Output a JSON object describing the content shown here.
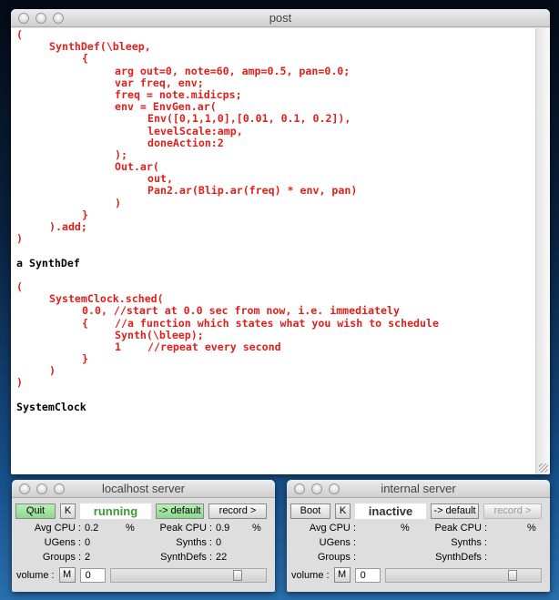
{
  "post": {
    "title": "post",
    "lines": [
      {
        "t": "(",
        "c": "code"
      },
      {
        "t": "\tSynthDef(\\bleep,",
        "c": "code"
      },
      {
        "t": "\t\t{",
        "c": "code"
      },
      {
        "t": "\t\t\targ out=0, note=60, amp=0.5, pan=0.0;",
        "c": "code"
      },
      {
        "t": "\t\t\tvar freq, env;",
        "c": "code"
      },
      {
        "t": "\t\t\tfreq = note.midicps;",
        "c": "code"
      },
      {
        "t": "\t\t\tenv = EnvGen.ar(",
        "c": "code"
      },
      {
        "t": "\t\t\t\tEnv([0,1,1,0],[0.01, 0.1, 0.2]),",
        "c": "code"
      },
      {
        "t": "\t\t\t\tlevelScale:amp,",
        "c": "code"
      },
      {
        "t": "\t\t\t\tdoneAction:2",
        "c": "code"
      },
      {
        "t": "\t\t\t);",
        "c": "code"
      },
      {
        "t": "\t\t\tOut.ar(",
        "c": "code"
      },
      {
        "t": "\t\t\t\tout,",
        "c": "code"
      },
      {
        "t": "\t\t\t\tPan2.ar(Blip.ar(freq) * env, pan)",
        "c": "code"
      },
      {
        "t": "\t\t\t)",
        "c": "code"
      },
      {
        "t": "\t\t}",
        "c": "code"
      },
      {
        "t": "\t).add;",
        "c": "code"
      },
      {
        "t": ")",
        "c": "code"
      },
      {
        "t": "",
        "c": "code"
      },
      {
        "t": "a SynthDef",
        "c": "out"
      },
      {
        "t": "",
        "c": "code"
      },
      {
        "t": "(",
        "c": "code"
      },
      {
        "t": "\tSystemClock.sched(",
        "c": "code"
      },
      {
        "t": "\t\t0.0, //start at 0.0 sec from now, i.e. immediately",
        "c": "code"
      },
      {
        "t": "\t\t{\t//a function which states what you wish to schedule",
        "c": "code"
      },
      {
        "t": "\t\t\tSynth(\\bleep);",
        "c": "code"
      },
      {
        "t": "\t\t\t1\t//repeat every second",
        "c": "code"
      },
      {
        "t": "\t\t}",
        "c": "code"
      },
      {
        "t": "\t)",
        "c": "code"
      },
      {
        "t": ")",
        "c": "code"
      },
      {
        "t": "",
        "c": "code"
      },
      {
        "t": "SystemClock",
        "c": "out"
      }
    ]
  },
  "servers": [
    {
      "title": "localhost server",
      "boot_label": "Quit",
      "kill_label": "K",
      "status": "running",
      "status_color": "#3a9a3a",
      "default_label": "-> default",
      "record_label": "record >",
      "avg_cpu_label": "Avg CPU :",
      "avg_cpu": "0.2",
      "peak_cpu_label": "Peak CPU :",
      "peak_cpu": "0.9",
      "pct": "%",
      "ugens_label": "UGens :",
      "ugens": "0",
      "synths_label": "Synths :",
      "synths": "0",
      "groups_label": "Groups :",
      "groups": "2",
      "synthdefs_label": "SynthDefs :",
      "synthdefs": "22",
      "volume_label": "volume :",
      "mute_label": "M",
      "volume": "0",
      "volume_fraction": 0.85
    },
    {
      "title": "internal server",
      "boot_label": "Boot",
      "kill_label": "K",
      "status": "inactive",
      "status_color": "#333333",
      "default_label": "-> default",
      "record_label": "record >",
      "avg_cpu_label": "Avg CPU :",
      "avg_cpu": "",
      "peak_cpu_label": "Peak CPU :",
      "peak_cpu": "",
      "pct": "%",
      "ugens_label": "UGens :",
      "ugens": "",
      "synths_label": "Synths :",
      "synths": "",
      "groups_label": "Groups :",
      "groups": "",
      "synthdefs_label": "SynthDefs :",
      "synthdefs": "",
      "volume_label": "volume :",
      "mute_label": "M",
      "volume": "0",
      "volume_fraction": 0.85
    }
  ]
}
